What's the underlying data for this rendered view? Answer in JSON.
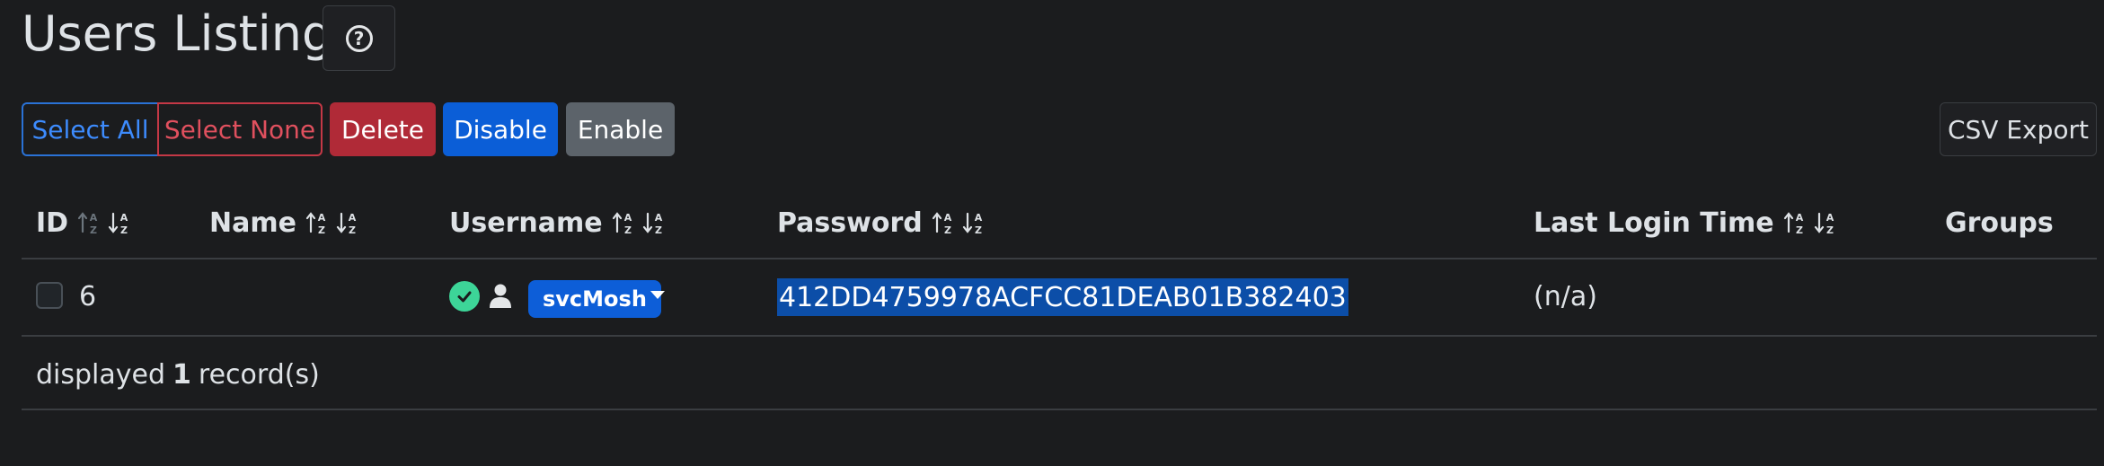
{
  "header": {
    "title": "Users Listing",
    "help_glyph": "?"
  },
  "toolbar": {
    "select_all": "Select All",
    "select_none": "Select None",
    "delete": "Delete",
    "disable": "Disable",
    "enable": "Enable",
    "csv_export": "CSV Export"
  },
  "table": {
    "columns": [
      {
        "label": "ID",
        "sortable": true
      },
      {
        "label": "Name",
        "sortable": true
      },
      {
        "label": "Username",
        "sortable": true
      },
      {
        "label": "Password",
        "sortable": true
      },
      {
        "label": "Last Login Time",
        "sortable": true
      },
      {
        "label": "Groups",
        "sortable": false
      }
    ],
    "rows": [
      {
        "id": "6",
        "name": "",
        "username": "svcMosh",
        "password": "412DD4759978ACFCC81DEAB01B382403",
        "last_login": "(n/a)",
        "groups": "",
        "status_icon": "check-circle-icon",
        "type_icon": "person-icon"
      }
    ]
  },
  "footer": {
    "prefix": "displayed",
    "count": "1",
    "suffix": "record(s)"
  },
  "colors": {
    "background": "#1b1c1e",
    "primary": "#0d6efd",
    "danger": "#b02a37",
    "secondary": "#5c636a",
    "success": "#3dd598",
    "selection": "#0c4ea8"
  }
}
